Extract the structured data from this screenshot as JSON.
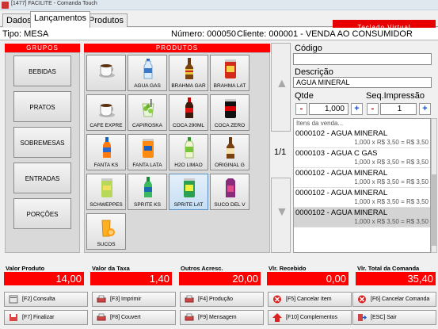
{
  "window": {
    "title": "[1477] FACILITE - Comanda Touch"
  },
  "tabs": [
    {
      "label": "Dados"
    },
    {
      "label": "Lançamentos"
    },
    {
      "label": "Produtos"
    }
  ],
  "keyboard_button": "Teclado Virtual",
  "info": {
    "tipo": "Tipo: MESA",
    "numero": "Número: 000050",
    "cliente": "Cliente: 000001 - VENDA AO CONSUMIDOR"
  },
  "groups": {
    "header": "GRUPOS",
    "items": [
      "BEBIDAS",
      "PRATOS",
      "SOBREMESAS",
      "ENTRADAS",
      "PORÇÕES"
    ]
  },
  "products": {
    "header": "PRODUTOS",
    "items": [
      {
        "label": "",
        "icon": "coffee-cup-icon"
      },
      {
        "label": "AGUA GÁS",
        "icon": "water-bottle-icon"
      },
      {
        "label": "BRAHMA GAR",
        "icon": "beer-bottle-icon"
      },
      {
        "label": "BRAHMA LAT",
        "icon": "beer-can-icon"
      },
      {
        "label": "CAFE EXPRE",
        "icon": "coffee-cup-icon"
      },
      {
        "label": "CAPIROSKA",
        "icon": "cocktail-icon"
      },
      {
        "label": "COCA 290ML",
        "icon": "soda-bottle-icon"
      },
      {
        "label": "COCA ZERO",
        "icon": "soda-can-icon"
      },
      {
        "label": "FANTA KS",
        "icon": "orange-soda-bottle-icon"
      },
      {
        "label": "FANTA LATA",
        "icon": "orange-soda-can-icon"
      },
      {
        "label": "H2O LIMAO",
        "icon": "lemon-soda-bottle-icon"
      },
      {
        "label": "ORIGINAL G",
        "icon": "beer-bottle-icon"
      },
      {
        "label": "SCHWEPPES",
        "icon": "schweppes-can-icon"
      },
      {
        "label": "SPRITE KS",
        "icon": "sprite-bottle-icon"
      },
      {
        "label": "SPRITE LAT",
        "icon": "sprite-can-icon"
      },
      {
        "label": "SUCO DEL V",
        "icon": "juice-box-icon"
      },
      {
        "label": "SUCOS",
        "icon": "orange-juice-icon"
      }
    ]
  },
  "page_indicator": "1/1",
  "right": {
    "codigo_label": "Código",
    "codigo_value": "",
    "descricao_label": "Descrição",
    "descricao_value": "AGUA MINERAL",
    "qtde_label": "Qtde",
    "qtde_value": "1,000",
    "seq_label": "Seq.Impressão",
    "seq_value": "1",
    "minus": "-",
    "plus": "+",
    "items_header": "Itens da venda...",
    "items": [
      {
        "name": "0000102 - AGUA MINERAL",
        "price": "1,000 x R$ 3,50 = R$ 3,50"
      },
      {
        "name": "0000103 - AGUA C GAS",
        "price": "1,000 x R$ 3,50 = R$ 3,50"
      },
      {
        "name": "0000102 - AGUA MINERAL",
        "price": "1,000 x R$ 3,50 = R$ 3,50"
      },
      {
        "name": "0000102 - AGUA MINERAL",
        "price": "1,000 x R$ 3,50 = R$ 3,50"
      },
      {
        "name": "0000102 - AGUA MINERAL",
        "price": "1,000 x R$ 3,50 = R$ 3,50"
      }
    ]
  },
  "totals": [
    {
      "label": "Valor Produto",
      "value": "14,00"
    },
    {
      "label": "Valor da Taxa",
      "value": "1,40"
    },
    {
      "label": "Outros Acresc.",
      "value": "20,00"
    },
    {
      "label": "Vlr. Recebido",
      "value": "0,00"
    },
    {
      "label": "Vlr. Total da Comanda",
      "value": "35,40"
    }
  ],
  "buttons": [
    {
      "label": "[F2] Consulta",
      "icon": "search-icon"
    },
    {
      "label": "[F3] Imprimir",
      "icon": "printer-icon"
    },
    {
      "label": "[F4] Produção",
      "icon": "printer-icon"
    },
    {
      "label": "[F5] Cancelar Item",
      "icon": "cancel-icon"
    },
    {
      "label": "[F6] Cancelar Comanda",
      "icon": "cancel-icon"
    },
    {
      "label": "[F7] Finalizar",
      "icon": "save-icon"
    },
    {
      "label": "[F8] Couvert",
      "icon": "printer-icon"
    },
    {
      "label": "[F9] Mensagem",
      "icon": "printer-icon"
    },
    {
      "label": "[F10] Complementos",
      "icon": "arrow-up-icon"
    },
    {
      "label": "[ESC] Sair",
      "icon": "exit-icon"
    }
  ],
  "colors": {
    "accent": "#ff0000",
    "selected_product": "#c6def4"
  }
}
